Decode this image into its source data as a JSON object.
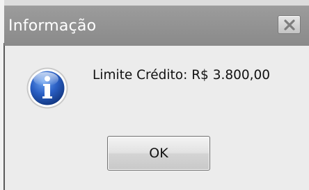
{
  "window": {
    "title": "Informação"
  },
  "message": {
    "text": "Limite Crédito: R$ 3.800,00"
  },
  "buttons": {
    "ok_label": "OK"
  },
  "icons": {
    "main": "info-icon",
    "close": "close-icon"
  },
  "colors": {
    "titlebar": "#8f8f8f",
    "icon_blue": "#1f4fa8"
  }
}
